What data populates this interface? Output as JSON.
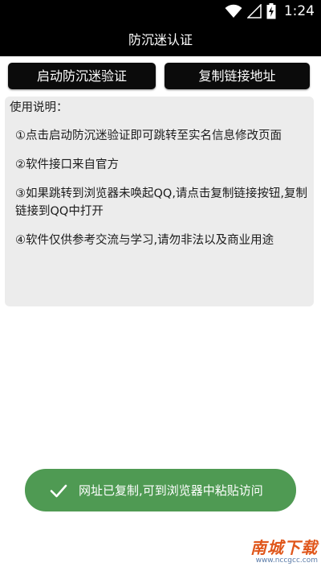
{
  "status_bar": {
    "time": "1:24",
    "icons": [
      "wifi-icon",
      "signal-icon",
      "battery-charging-icon"
    ]
  },
  "app": {
    "title": "防沉迷认证"
  },
  "buttons": {
    "start_verify": "启动防沉迷验证",
    "copy_link": "复制链接地址"
  },
  "instructions": {
    "heading": "使用说明：",
    "items": [
      "①点击启动防沉迷验证即可跳转至实名信息修改页面",
      "②软件接口来自官方",
      "③如果跳转到浏览器未唤起QQ,请点击复制链接按钮,复制链接到QQ中打开",
      "④软件仅供参考交流与学习,请勿非法以及商业用途"
    ]
  },
  "toast": {
    "message": "网址已复制,可到浏览器中粘贴访问",
    "icon": "check-icon",
    "color": "#4f9a53"
  },
  "watermark": {
    "brand": "南城下载",
    "url": "www.nccgcc.com"
  },
  "colors": {
    "bar_background": "#000000",
    "button_background": "#0b0b0b",
    "panel_background": "#ececec",
    "toast_background": "#4f9a53"
  }
}
